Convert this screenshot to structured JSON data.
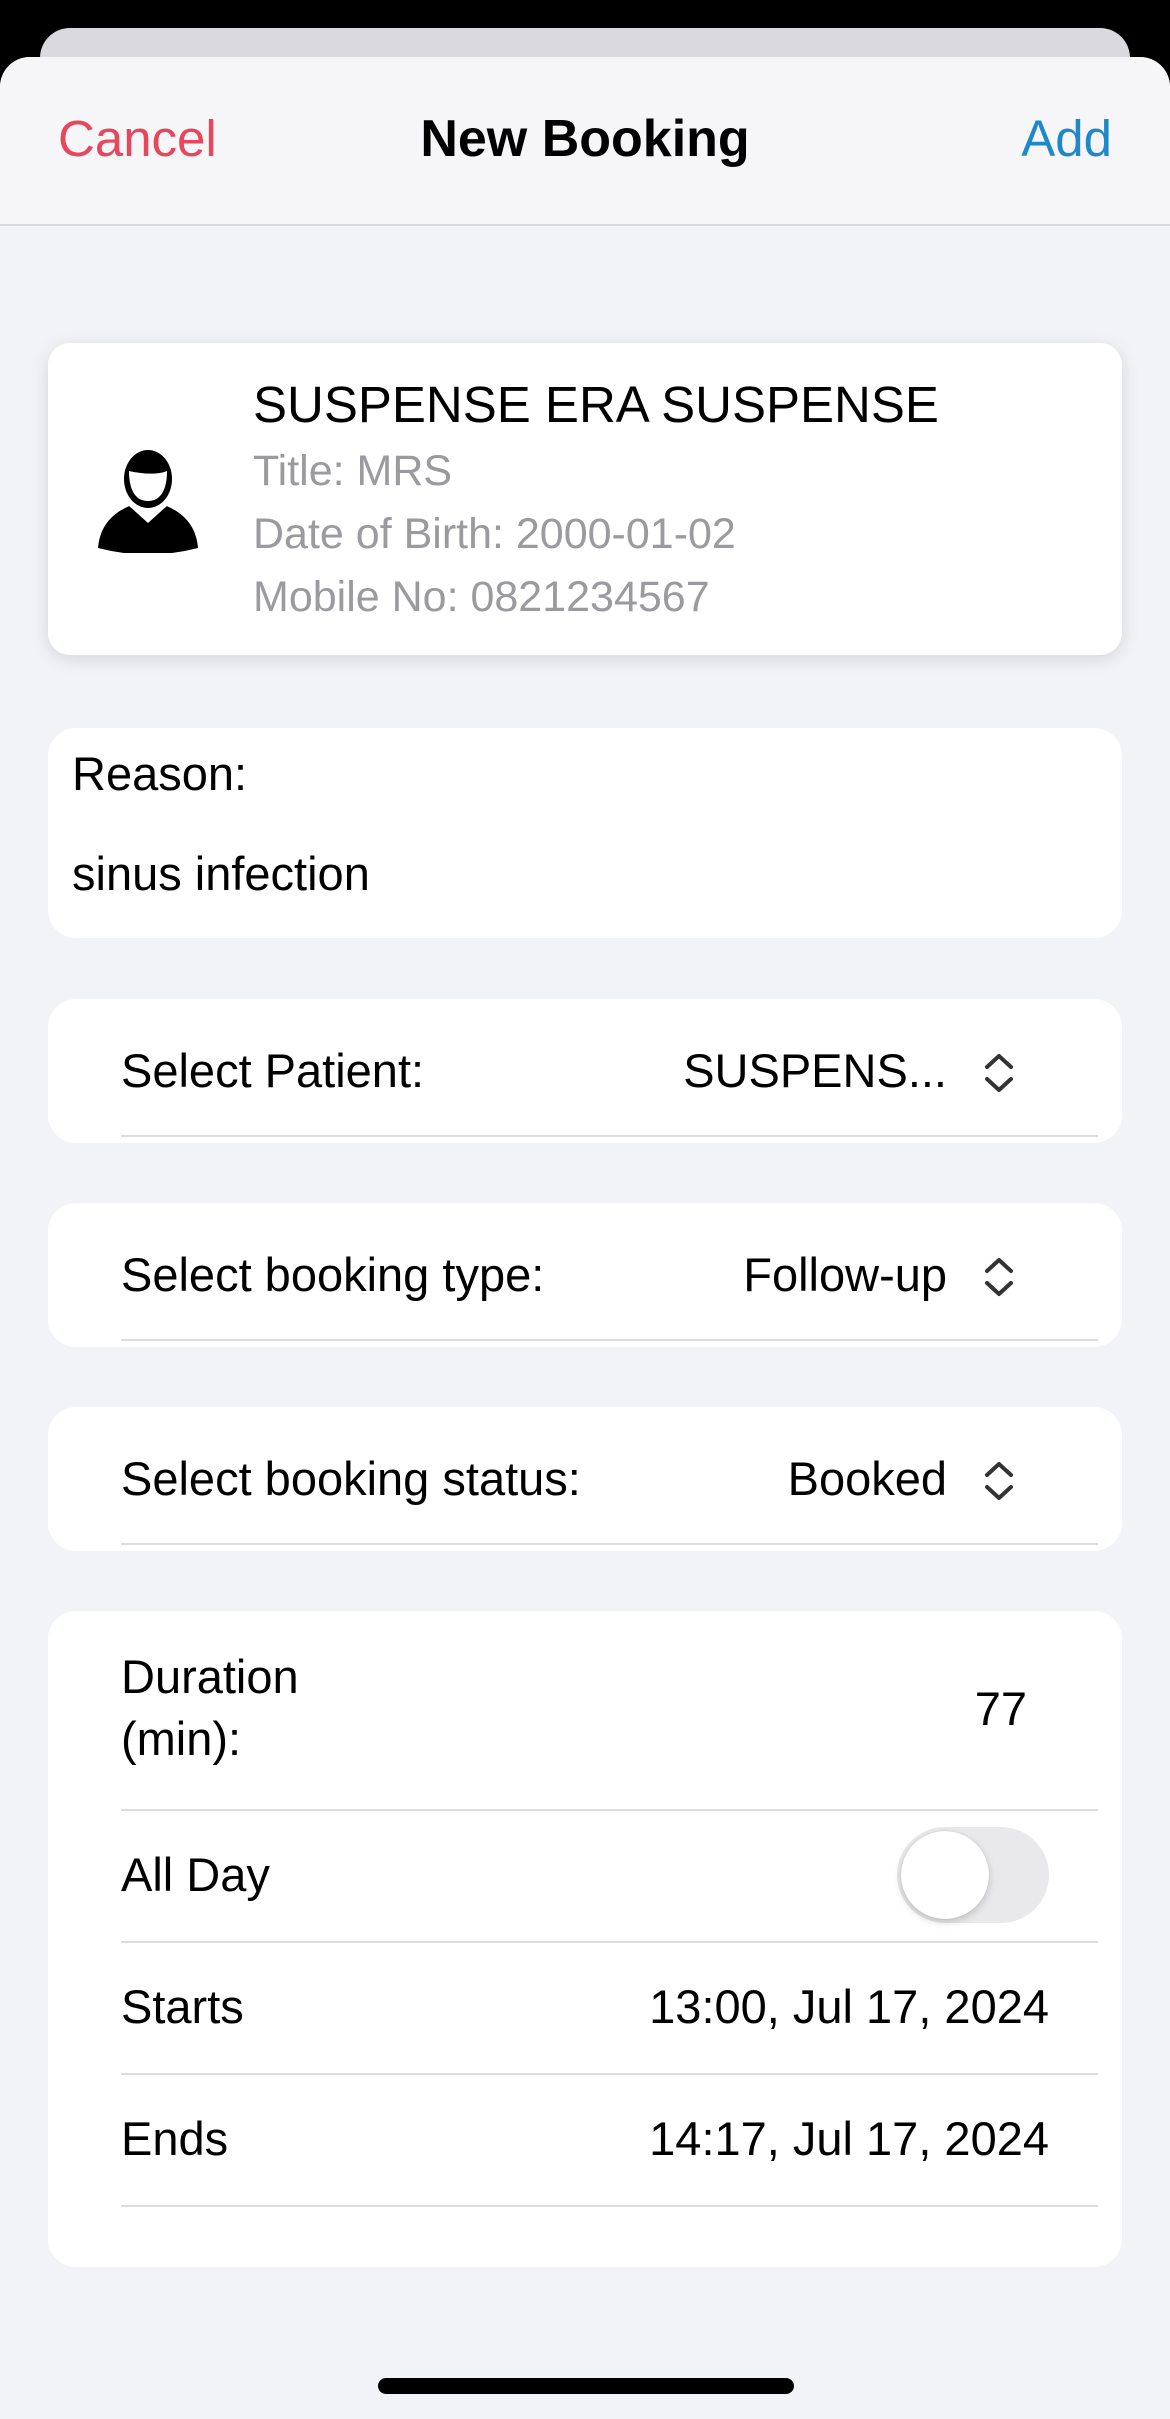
{
  "nav": {
    "cancel_label": "Cancel",
    "title": "New Booking",
    "add_label": "Add"
  },
  "patient": {
    "name": "SUSPENSE ERA SUSPENSE",
    "title_line": "Title: MRS",
    "dob_line": "Date of Birth: 2000-01-02",
    "mobile_line": "Mobile No: 0821234567",
    "icon": "person-icon"
  },
  "reason": {
    "label": "Reason:",
    "value": "sinus infection"
  },
  "select_patient": {
    "label": "Select Patient:",
    "value": "SUSPENS..."
  },
  "booking_type": {
    "label": "Select booking type:",
    "value": "Follow-up"
  },
  "booking_status": {
    "label": "Select booking status:",
    "value": "Booked"
  },
  "details": {
    "duration_label_1": "Duration",
    "duration_label_2": "(min):",
    "duration_value": "77",
    "all_day_label": "All Day",
    "all_day_on": false,
    "starts_label": "Starts",
    "starts_value": "13:00, Jul 17, 2024",
    "ends_label": "Ends",
    "ends_value": "14:17, Jul 17, 2024"
  },
  "colors": {
    "cancel": "#e5475d",
    "add": "#1e88c9",
    "background": "#f2f3f7"
  }
}
